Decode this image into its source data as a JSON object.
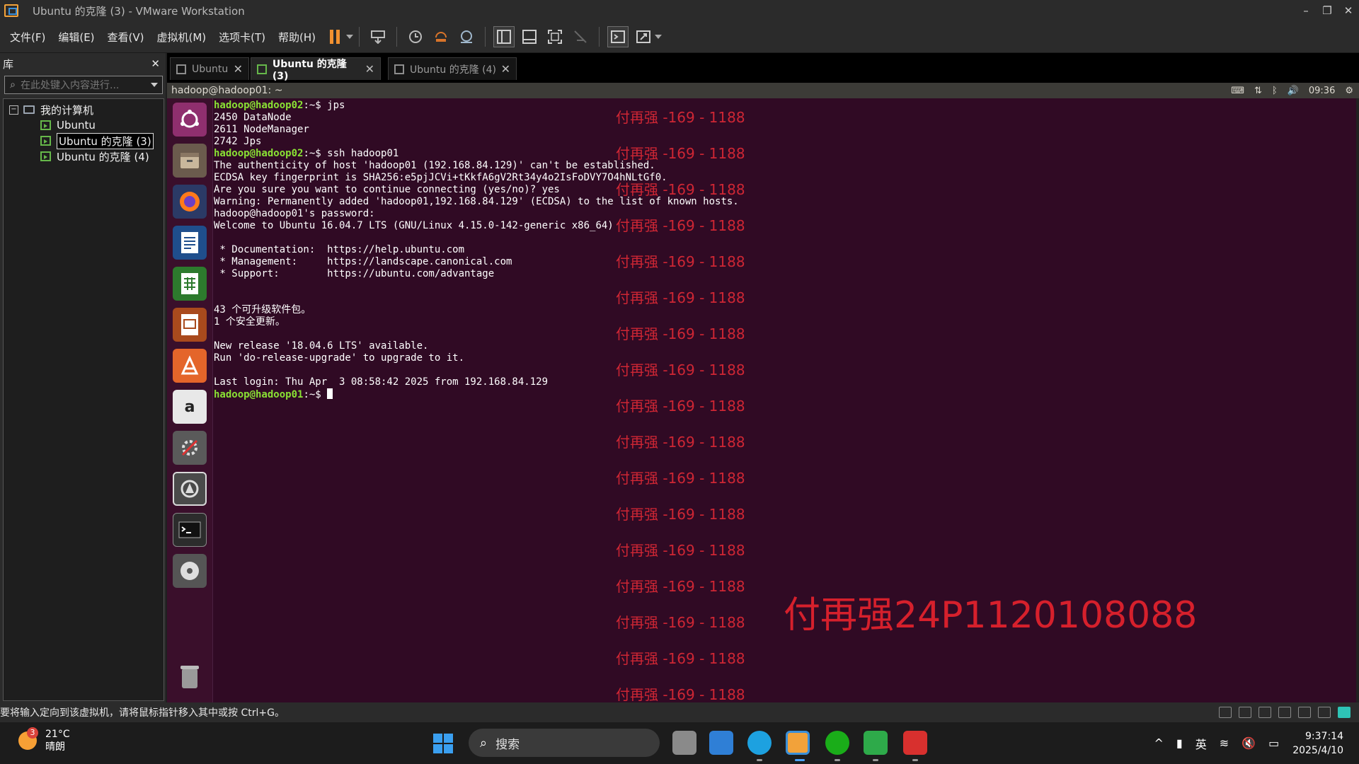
{
  "window": {
    "title": "Ubuntu 的克隆 (3) - VMware Workstation",
    "controls": [
      "–",
      "❐",
      "✕"
    ]
  },
  "menu": [
    "文件(F)",
    "编辑(E)",
    "查看(V)",
    "虚拟机(M)",
    "选项卡(T)",
    "帮助(H)"
  ],
  "library": {
    "title": "库",
    "close": "✕",
    "search_placeholder": "在此处键入内容进行...",
    "tree": {
      "root_toggle": "−",
      "root": "我的计算机",
      "items": [
        "Ubuntu",
        "Ubuntu 的克隆 (3)",
        "Ubuntu 的克隆 (4)"
      ]
    }
  },
  "tabs": [
    {
      "label": "Ubuntu",
      "active": false
    },
    {
      "label": "Ubuntu 的克隆 (3)",
      "active": true
    },
    {
      "label": "Ubuntu 的克隆 (4)",
      "active": false
    }
  ],
  "ubuntu_panel": {
    "title": "hadoop@hadoop01: ~",
    "time": "09:36"
  },
  "terminal": {
    "lines": [
      {
        "prompt": "hadoop@hadoop02",
        "suffix": ":~$ ",
        "text": "jps"
      },
      {
        "text": "2450 DataNode"
      },
      {
        "text": "2611 NodeManager"
      },
      {
        "text": "2742 Jps"
      },
      {
        "prompt": "hadoop@hadoop02",
        "suffix": ":~$ ",
        "text": "ssh hadoop01"
      },
      {
        "text": "The authenticity of host 'hadoop01 (192.168.84.129)' can't be established."
      },
      {
        "text": "ECDSA key fingerprint is SHA256:e5pjJCVi+tKkfA6gV2Rt34y4o2IsFoDVY7O4hNLtGf0."
      },
      {
        "text": "Are you sure you want to continue connecting (yes/no)? yes"
      },
      {
        "text": "Warning: Permanently added 'hadoop01,192.168.84.129' (ECDSA) to the list of known hosts."
      },
      {
        "text": "hadoop@hadoop01's password:"
      },
      {
        "text": "Welcome to Ubuntu 16.04.7 LTS (GNU/Linux 4.15.0-142-generic x86_64)"
      },
      {
        "text": ""
      },
      {
        "text": " * Documentation:  https://help.ubuntu.com"
      },
      {
        "text": " * Management:     https://landscape.canonical.com"
      },
      {
        "text": " * Support:        https://ubuntu.com/advantage"
      },
      {
        "text": ""
      },
      {
        "text": ""
      },
      {
        "text": "43 个可升级软件包。"
      },
      {
        "text": "1 个安全更新。"
      },
      {
        "text": ""
      },
      {
        "text": "New release '18.04.6 LTS' available."
      },
      {
        "text": "Run 'do-release-upgrade' to upgrade to it."
      },
      {
        "text": ""
      },
      {
        "text": "Last login: Thu Apr  3 08:58:42 2025 from 192.168.84.129"
      },
      {
        "prompt": "hadoop@hadoop01",
        "suffix": ":~$ ",
        "text": "",
        "cursor": true
      }
    ]
  },
  "watermark": {
    "repeated": "付再强 -169 - 1188",
    "big": "付再强24P1120108088"
  },
  "statusbar": {
    "text": "要将输入定向到该虚拟机，请将鼠标指针移入其中或按 Ctrl+G。"
  },
  "taskbar": {
    "weather_badge": "3",
    "temperature": "21°C",
    "condition": "晴朗",
    "search_label": "搜索",
    "ime": "英",
    "time": "9:37:14",
    "date": "2025/4/10"
  },
  "colors": {
    "terminal_bg": "#300a24",
    "prompt": "#8ae234",
    "watermark": "#e02a36",
    "launcher_bg": "#3a0f2b"
  }
}
